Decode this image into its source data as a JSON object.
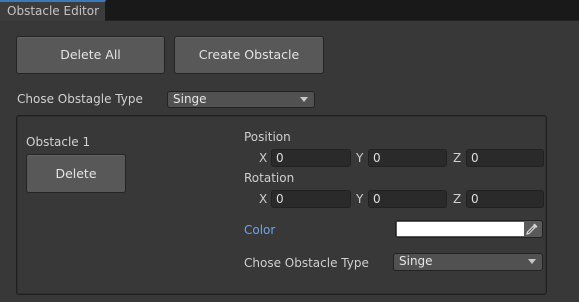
{
  "window": {
    "tab_title": "Obstacle Editor"
  },
  "toolbar": {
    "delete_all_label": "Delete All",
    "create_obstacle_label": "Create Obstacle",
    "type_label": "Chose Obstagle Type",
    "type_value": "Singe"
  },
  "obstacle": {
    "title": "Obstacle 1",
    "delete_label": "Delete",
    "position": {
      "label": "Position",
      "x_label": "X",
      "x": "0",
      "y_label": "Y",
      "y": "0",
      "z_label": "Z",
      "z": "0"
    },
    "rotation": {
      "label": "Rotation",
      "x_label": "X",
      "x": "0",
      "y_label": "Y",
      "y": "0",
      "z_label": "Z",
      "z": "0"
    },
    "color": {
      "label": "Color",
      "value": "#ffffff",
      "picker_icon": "eyedropper-icon"
    },
    "type_label": "Chose Obstacle Type",
    "type_value": "Singe"
  },
  "colors": {
    "tab_accent": "#3a79bb",
    "color_label": "#6aa4e8",
    "background": "#383838"
  }
}
